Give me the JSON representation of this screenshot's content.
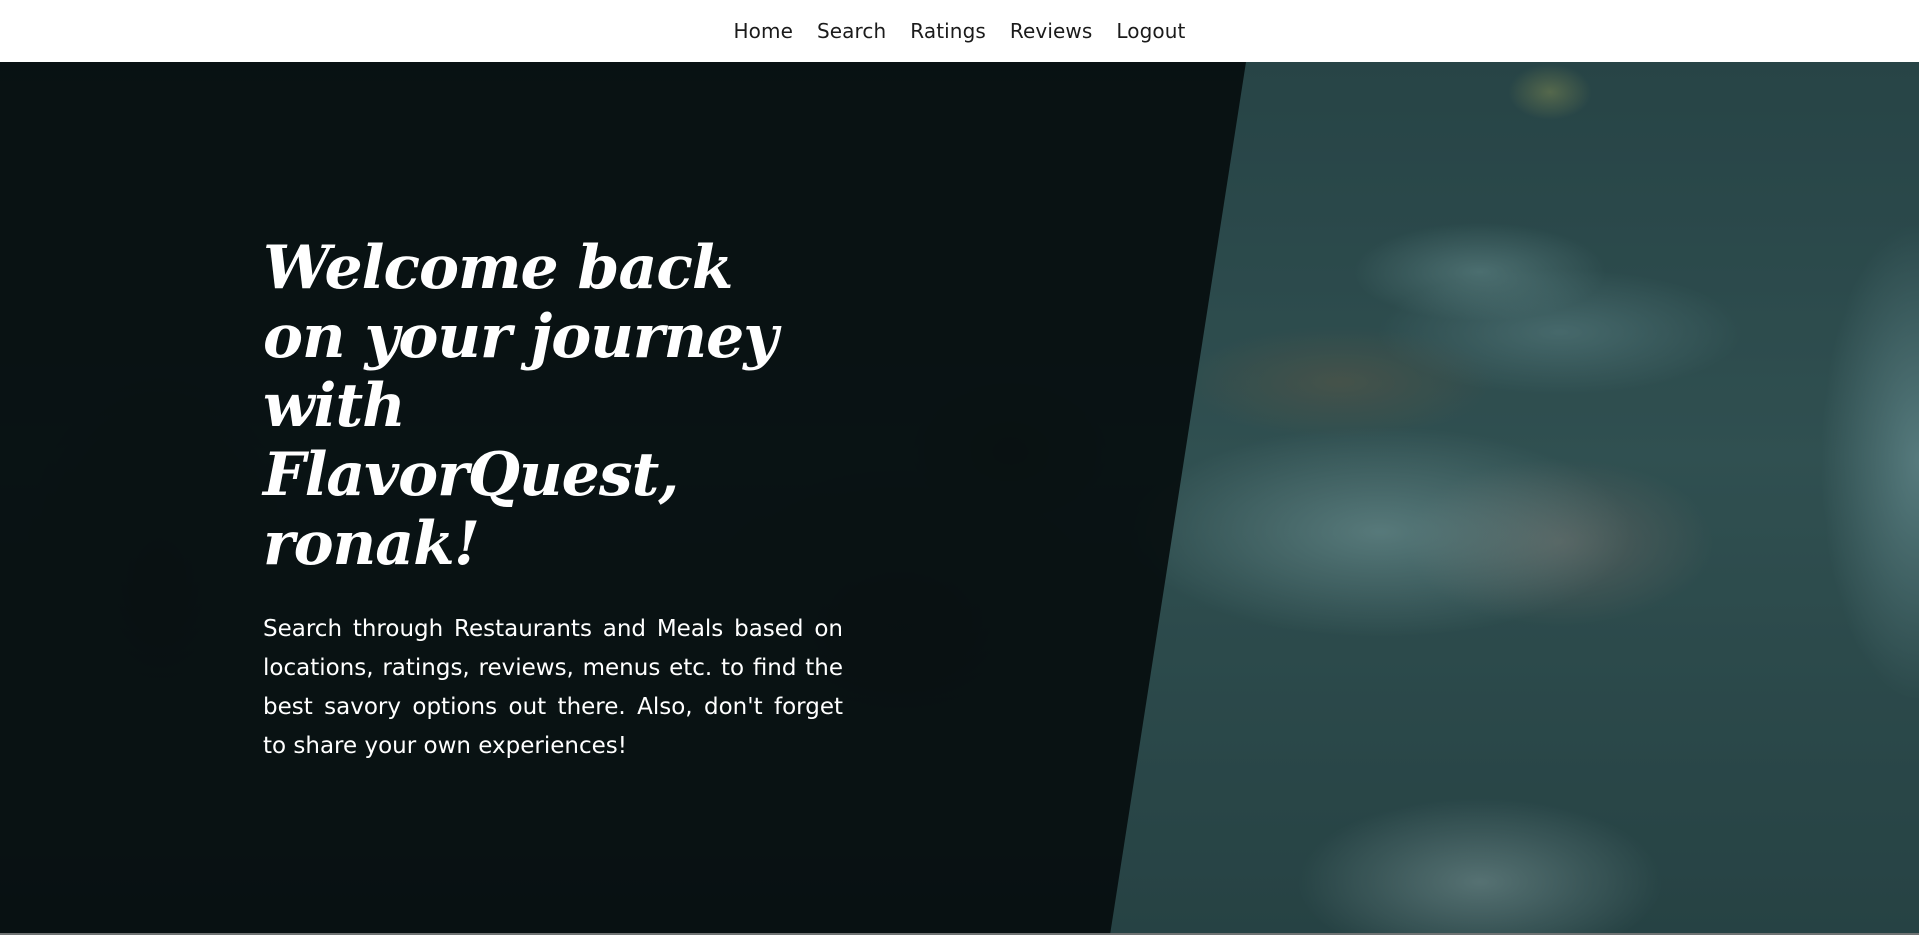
{
  "nav": {
    "items": [
      {
        "label": "Home"
      },
      {
        "label": "Search"
      },
      {
        "label": "Ratings"
      },
      {
        "label": "Reviews"
      },
      {
        "label": "Logout"
      }
    ]
  },
  "hero": {
    "title": "Welcome back on your journey with FlavorQuest, ronak!",
    "description": "Search through Restaurants and Meals based on locations, ratings, reviews, menus etc. to find the best savory options out there. Also, don't forget to share your own experiences!"
  },
  "colors": {
    "nav_background": "#ffffff",
    "nav_text": "#1b1b1b",
    "hero_overlay": "#060c0d",
    "hero_text": "#ffffff",
    "photo_tint": "#2d4446"
  }
}
